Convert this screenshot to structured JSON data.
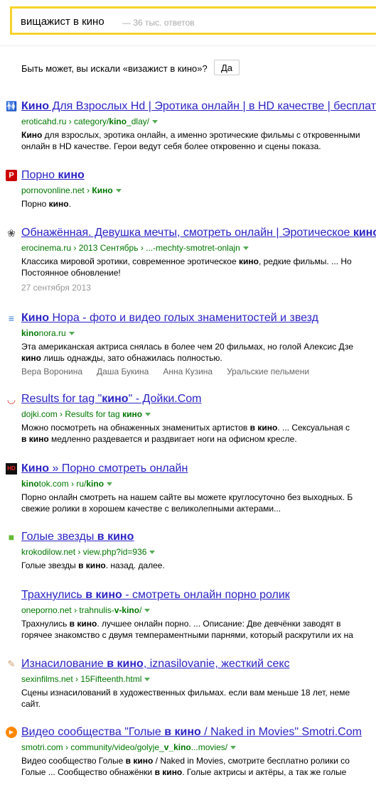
{
  "search": {
    "query": "вищажист в кино",
    "count": "— 36 тыс. ответов"
  },
  "suggestion": {
    "text": "Быть может, вы искали «визажист в кино»?",
    "button": "Да"
  },
  "results": [
    {
      "icon": "adult-figures-icon",
      "title_parts": [
        {
          "t": "Кино",
          "b": true
        },
        {
          "t": " Для Взрослых Hd | Эротика онлайн | в HD качестве | бесплатно",
          "b": false
        }
      ],
      "url_parts": [
        {
          "t": "eroticahd.ru › category/",
          "b": false
        },
        {
          "t": "kino",
          "b": true
        },
        {
          "t": "_dlay/",
          "b": false
        }
      ],
      "snippet": [
        [
          {
            "t": "Кино",
            "b": true
          },
          {
            "t": " для взрослых, эротика онлайн, а именно эротические фильмы с откровенными",
            "b": false
          }
        ],
        [
          {
            "t": "онлайн в HD качестве. Герои ведут себя более откровенно и сцены показа.",
            "b": false
          }
        ]
      ]
    },
    {
      "icon": "porno-p-icon",
      "title_parts": [
        {
          "t": "Порно ",
          "b": false
        },
        {
          "t": "кино",
          "b": true
        }
      ],
      "url_parts": [
        {
          "t": "pornovonline.net › ",
          "b": false
        },
        {
          "t": "Кино",
          "b": true
        }
      ],
      "snippet": [
        [
          {
            "t": "Порно ",
            "b": false
          },
          {
            "t": "кино",
            "b": true
          },
          {
            "t": ".",
            "b": false
          }
        ]
      ]
    },
    {
      "icon": "film-reel-icon",
      "title_parts": [
        {
          "t": "Обнажённая. Девушка мечты, смотреть онлайн | Эротическое ",
          "b": false
        },
        {
          "t": "кино",
          "b": true
        },
        {
          "t": "...",
          "b": false
        }
      ],
      "url_parts": [
        {
          "t": "erocinema.ru › 2013 Сентябрь › ...-mechty-smotret-onlajn",
          "b": false
        }
      ],
      "snippet": [
        [
          {
            "t": "Классика мировой эротики, современное эротическое ",
            "b": false
          },
          {
            "t": "кино",
            "b": true
          },
          {
            "t": ", редкие фильмы. ... Но",
            "b": false
          }
        ],
        [
          {
            "t": "Постоянное обновление!",
            "b": false
          }
        ]
      ],
      "date": "27 сентября 2013"
    },
    {
      "icon": "kinonora-icon",
      "title_parts": [
        {
          "t": "Кино",
          "b": true
        },
        {
          "t": " Нора - фото и видео голых знаменитостей и звезд",
          "b": false
        }
      ],
      "url_parts": [
        {
          "t": "kino",
          "b": true
        },
        {
          "t": "nora.ru",
          "b": false
        }
      ],
      "snippet": [
        [
          {
            "t": "Эта американская актриса снялась в более чем 20 фильмах, но голой Алексис Дзе",
            "b": false
          }
        ],
        [
          {
            "t": "кино",
            "b": true
          },
          {
            "t": " лишь однажды, зато обнажилась полностью.",
            "b": false
          }
        ]
      ],
      "sitelinks": [
        "Вера Воронина",
        "Даша Букина",
        "Анна Кузина",
        "Уральские пельмени"
      ]
    },
    {
      "icon": "lips-icon",
      "title_parts": [
        {
          "t": "Results for tag \"",
          "b": false
        },
        {
          "t": "кино",
          "b": true
        },
        {
          "t": "\" - Дойки.Com",
          "b": false
        }
      ],
      "url_parts": [
        {
          "t": "dojki.com › Results for tag ",
          "b": false
        },
        {
          "t": "кино",
          "b": true
        }
      ],
      "snippet": [
        [
          {
            "t": "Можно посмотреть на обнаженных знаменитых артистов ",
            "b": false
          },
          {
            "t": "в кино",
            "b": true
          },
          {
            "t": ". ... Сексуальная с",
            "b": false
          }
        ],
        [
          {
            "t": "в кино",
            "b": true
          },
          {
            "t": " медленно раздевается и раздвигает ноги на офисном кресле.",
            "b": false
          }
        ]
      ]
    },
    {
      "icon": "hd-icon",
      "title_parts": [
        {
          "t": "Кино",
          "b": true
        },
        {
          "t": " » Порно смотреть онлайн",
          "b": false
        }
      ],
      "url_parts": [
        {
          "t": "kino",
          "b": true
        },
        {
          "t": "tok.com › ru/",
          "b": false
        },
        {
          "t": "kino",
          "b": true
        }
      ],
      "snippet": [
        [
          {
            "t": "Порно онлайн смотреть на нашем сайте вы можете круглосуточно без выходных. Б",
            "b": false
          }
        ],
        [
          {
            "t": "свежие ролики в хорошем качестве с великолепными актерами...",
            "b": false
          }
        ]
      ]
    },
    {
      "icon": "crocodile-icon",
      "title_parts": [
        {
          "t": "Голые звезды ",
          "b": false
        },
        {
          "t": "в кино",
          "b": true
        }
      ],
      "url_parts": [
        {
          "t": "krokodilow.net › view.php?id=936",
          "b": false
        }
      ],
      "snippet": [
        [
          {
            "t": "Голые звезды ",
            "b": false
          },
          {
            "t": "в кино",
            "b": true
          },
          {
            "t": ". назад. далее.",
            "b": false
          }
        ]
      ]
    },
    {
      "icon": "none",
      "title_parts": [
        {
          "t": "Трахнулись ",
          "b": false
        },
        {
          "t": "в кино",
          "b": true
        },
        {
          "t": " - смотреть онлайн порно ролик",
          "b": false
        }
      ],
      "url_parts": [
        {
          "t": "oneporno.net › trahnulis-",
          "b": false
        },
        {
          "t": "v-kino",
          "b": true
        },
        {
          "t": "/",
          "b": false
        }
      ],
      "snippet": [
        [
          {
            "t": "Трахнулись ",
            "b": false
          },
          {
            "t": "в кино",
            "b": true
          },
          {
            "t": ". лучшее онлайн порно. ... Описание: Две девчёнки заводят в",
            "b": false
          }
        ],
        [
          {
            "t": "горячее знакомство с двумя темпераментными парнями, который раскрутили их на",
            "b": false
          }
        ]
      ]
    },
    {
      "icon": "sexinfilms-icon",
      "title_parts": [
        {
          "t": "Изнасилование ",
          "b": false
        },
        {
          "t": "в кино",
          "b": true
        },
        {
          "t": ", iznasilovanie, жесткий секс",
          "b": false
        }
      ],
      "url_parts": [
        {
          "t": "sexinfilms.net › 15Fifteenth.html",
          "b": false
        }
      ],
      "snippet": [
        [
          {
            "t": "Сцены изнасилований в художественных фильмах. если вам меньше 18 лет, неме",
            "b": false
          }
        ],
        [
          {
            "t": "сайт.",
            "b": false
          }
        ]
      ]
    },
    {
      "icon": "play-icon",
      "title_parts": [
        {
          "t": "Видео сообщества \"Голые ",
          "b": false
        },
        {
          "t": "в кино",
          "b": true
        },
        {
          "t": " / Naked in Movies\" Smotri.Com",
          "b": false
        }
      ],
      "url_parts": [
        {
          "t": "smotri.com › community/video/golyje_",
          "b": false
        },
        {
          "t": "v_kino",
          "b": true
        },
        {
          "t": "...movies/",
          "b": false
        }
      ],
      "snippet": [
        [
          {
            "t": "Видео сообщество Голые ",
            "b": false
          },
          {
            "t": "в кино",
            "b": true
          },
          {
            "t": " / Naked in Movies, смотрите бесплатно ролики со",
            "b": false
          }
        ],
        [
          {
            "t": "Голые ... Сообщество обнажёнки ",
            "b": false
          },
          {
            "t": "в кино",
            "b": true
          },
          {
            "t": ". Голые актрисы и актёры, а так же голые",
            "b": false
          }
        ]
      ]
    }
  ]
}
